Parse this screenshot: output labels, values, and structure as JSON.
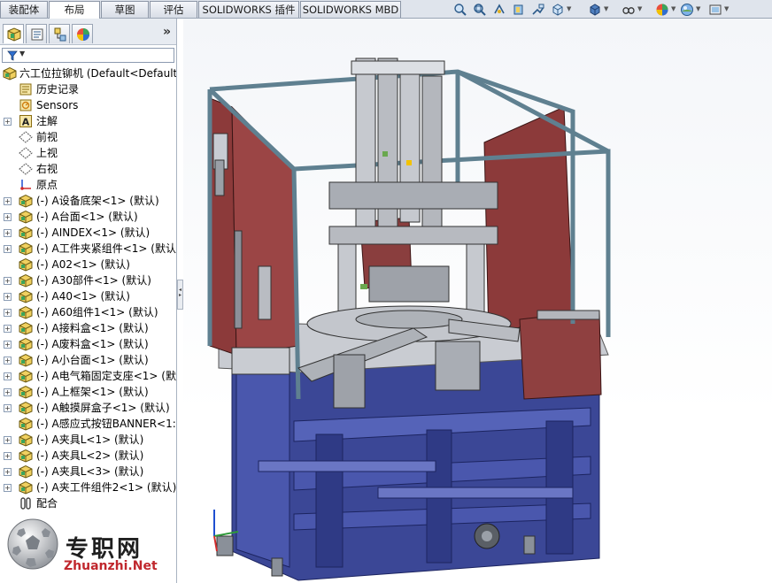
{
  "tabs": [
    "装配体",
    "布局",
    "草图",
    "评估",
    "SOLIDWORKS 插件",
    "SOLIDWORKS MBD"
  ],
  "view_toolbar_icons": [
    "zoom-to-fit-icon",
    "zoom-to-area-icon",
    "previous-view-icon",
    "section-view-icon",
    "dynamic-annotation-icon",
    "view-orientation-icon",
    "display-style-icon",
    "hide-show-items-icon",
    "edit-appearance-icon",
    "apply-scene-icon",
    "view-settings-icon"
  ],
  "panel": {
    "expand_glyph": "»",
    "tabs": [
      "featuremanager-icon",
      "propertymanager-icon",
      "configurationmanager-icon",
      "displaymanager-icon"
    ]
  },
  "tree": {
    "root": "六工位拉铆机  (Default<Default",
    "items": [
      {
        "label": "历史记录",
        "icon": "history-icon",
        "expander": false
      },
      {
        "label": "Sensors",
        "icon": "sensor-icon",
        "expander": false
      },
      {
        "label": "注解",
        "icon": "annotation-icon",
        "expander": true
      },
      {
        "label": "前视",
        "icon": "plane-icon",
        "expander": false
      },
      {
        "label": "上视",
        "icon": "plane-icon",
        "expander": false
      },
      {
        "label": "右视",
        "icon": "plane-icon",
        "expander": false
      },
      {
        "label": "原点",
        "icon": "origin-icon",
        "expander": false
      },
      {
        "label": "(-) A设备底架<1> (默认)",
        "icon": "subassembly-icon",
        "expander": true
      },
      {
        "label": "(-) A台面<1> (默认)",
        "icon": "subassembly-icon",
        "expander": true
      },
      {
        "label": "(-) AINDEX<1> (默认)",
        "icon": "subassembly-icon",
        "expander": true
      },
      {
        "label": "(-) A工件夹紧组件<1> (默认)",
        "icon": "subassembly-icon",
        "expander": true
      },
      {
        "label": "(-) A02<1> (默认)",
        "icon": "subassembly-icon",
        "expander": false
      },
      {
        "label": "(-) A30部件<1> (默认)",
        "icon": "subassembly-icon",
        "expander": true
      },
      {
        "label": "(-) A40<1> (默认)",
        "icon": "subassembly-icon",
        "expander": true
      },
      {
        "label": "(-) A60组件1<1> (默认)",
        "icon": "subassembly-icon",
        "expander": true
      },
      {
        "label": "(-) A接料盒<1> (默认)",
        "icon": "subassembly-icon",
        "expander": true
      },
      {
        "label": "(-) A废料盒<1> (默认)",
        "icon": "subassembly-icon",
        "expander": true
      },
      {
        "label": "(-) A小台面<1> (默认)",
        "icon": "subassembly-icon",
        "expander": true
      },
      {
        "label": "(-) A电气箱固定支座<1> (默认",
        "icon": "subassembly-icon",
        "expander": true
      },
      {
        "label": "(-) A上框架<1> (默认)",
        "icon": "subassembly-icon",
        "expander": true
      },
      {
        "label": "(-) A触摸屏盒子<1> (默认)",
        "icon": "subassembly-icon",
        "expander": true
      },
      {
        "label": "(-) A感应式按钮BANNER<1:",
        "icon": "subassembly-icon",
        "expander": false
      },
      {
        "label": "(-) A夹具L<1> (默认)",
        "icon": "subassembly-icon",
        "expander": true
      },
      {
        "label": "(-) A夹具L<2> (默认)",
        "icon": "subassembly-icon",
        "expander": true
      },
      {
        "label": "(-) A夹具L<3> (默认)",
        "icon": "subassembly-icon",
        "expander": true
      },
      {
        "label": "(-) A夹工件组件2<1> (默认)",
        "icon": "subassembly-icon",
        "expander": true
      },
      {
        "label": "配合",
        "icon": "mates-icon",
        "expander": false
      }
    ]
  },
  "watermark": {
    "cn": "专职网",
    "url": "Zhuanzhi.Net"
  },
  "colors": {
    "frame_blue": "#3f4c9e",
    "panel_red": "#8c3a3a",
    "steel_gray": "#b9bcc2",
    "profile_teal": "#5f8090",
    "accent_green": "#6aa84f",
    "accent_yellow": "#f2c200"
  }
}
